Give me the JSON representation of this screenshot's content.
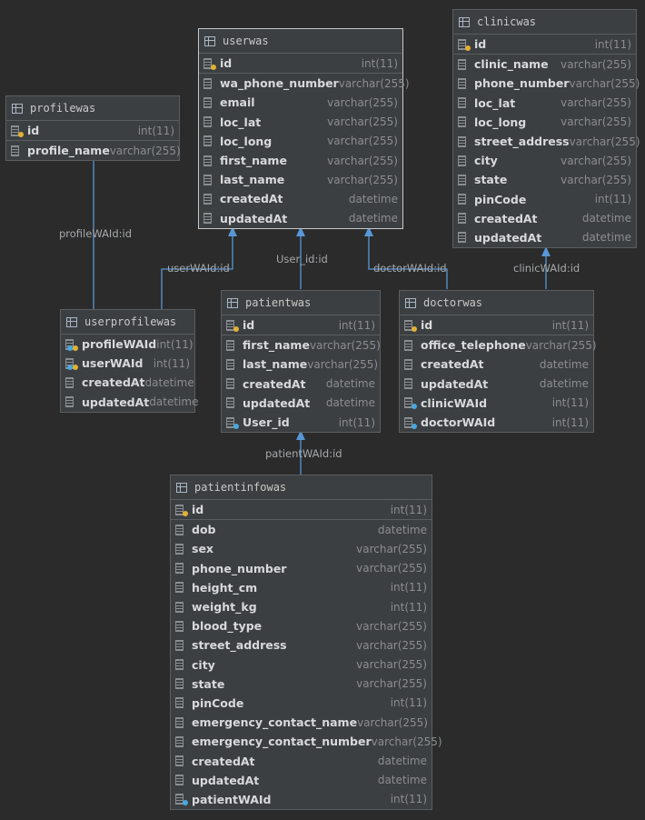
{
  "tables": [
    {
      "key": "userwas",
      "name": "userwas",
      "columns": [
        {
          "name": "id",
          "type": "int(11)",
          "icon": "primary-key-icon"
        },
        {
          "name": "wa_phone_number",
          "type": "varchar(255)",
          "icon": "column-icon"
        },
        {
          "name": "email",
          "type": "varchar(255)",
          "icon": "column-icon"
        },
        {
          "name": "loc_lat",
          "type": "varchar(255)",
          "icon": "column-icon"
        },
        {
          "name": "loc_long",
          "type": "varchar(255)",
          "icon": "column-icon"
        },
        {
          "name": "first_name",
          "type": "varchar(255)",
          "icon": "column-icon"
        },
        {
          "name": "last_name",
          "type": "varchar(255)",
          "icon": "column-icon"
        },
        {
          "name": "createdAt",
          "type": "datetime",
          "icon": "column-icon"
        },
        {
          "name": "updatedAt",
          "type": "datetime",
          "icon": "column-icon"
        }
      ]
    },
    {
      "key": "clinicwas",
      "name": "clinicwas",
      "columns": [
        {
          "name": "id",
          "type": "int(11)",
          "icon": "primary-key-icon"
        },
        {
          "name": "clinic_name",
          "type": "varchar(255)",
          "icon": "column-icon"
        },
        {
          "name": "phone_number",
          "type": "varchar(255)",
          "icon": "column-icon"
        },
        {
          "name": "loc_lat",
          "type": "varchar(255)",
          "icon": "column-icon"
        },
        {
          "name": "loc_long",
          "type": "varchar(255)",
          "icon": "column-icon"
        },
        {
          "name": "street_address",
          "type": "varchar(255)",
          "icon": "column-icon"
        },
        {
          "name": "city",
          "type": "varchar(255)",
          "icon": "column-icon"
        },
        {
          "name": "state",
          "type": "varchar(255)",
          "icon": "column-icon"
        },
        {
          "name": "pinCode",
          "type": "int(11)",
          "icon": "column-icon"
        },
        {
          "name": "createdAt",
          "type": "datetime",
          "icon": "column-icon"
        },
        {
          "name": "updatedAt",
          "type": "datetime",
          "icon": "column-icon"
        }
      ]
    },
    {
      "key": "profilewas",
      "name": "profilewas",
      "columns": [
        {
          "name": "id",
          "type": "int(11)",
          "icon": "primary-key-icon"
        },
        {
          "name": "profile_name",
          "type": "varchar(255)",
          "icon": "column-icon"
        }
      ]
    },
    {
      "key": "userprofilewas",
      "name": "userprofilewas",
      "columns": [
        {
          "name": "profileWAId",
          "type": "int(11)",
          "icon": "primary-foreign-key-icon"
        },
        {
          "name": "userWAId",
          "type": "int(11)",
          "icon": "primary-foreign-key-icon"
        },
        {
          "name": "createdAt",
          "type": "datetime",
          "icon": "column-icon"
        },
        {
          "name": "updatedAt",
          "type": "datetime",
          "icon": "column-icon"
        }
      ]
    },
    {
      "key": "patientwas",
      "name": "patientwas",
      "columns": [
        {
          "name": "id",
          "type": "int(11)",
          "icon": "primary-key-icon"
        },
        {
          "name": "first_name",
          "type": "varchar(255)",
          "icon": "column-icon"
        },
        {
          "name": "last_name",
          "type": "varchar(255)",
          "icon": "column-icon"
        },
        {
          "name": "createdAt",
          "type": "datetime",
          "icon": "column-icon"
        },
        {
          "name": "updatedAt",
          "type": "datetime",
          "icon": "column-icon"
        },
        {
          "name": "User_id",
          "type": "int(11)",
          "icon": "foreign-key-icon"
        }
      ]
    },
    {
      "key": "doctorwas",
      "name": "doctorwas",
      "columns": [
        {
          "name": "id",
          "type": "int(11)",
          "icon": "primary-key-icon"
        },
        {
          "name": "office_telephone",
          "type": "varchar(255)",
          "icon": "column-icon"
        },
        {
          "name": "createdAt",
          "type": "datetime",
          "icon": "column-icon"
        },
        {
          "name": "updatedAt",
          "type": "datetime",
          "icon": "column-icon"
        },
        {
          "name": "clinicWAId",
          "type": "int(11)",
          "icon": "foreign-key-icon"
        },
        {
          "name": "doctorWAId",
          "type": "int(11)",
          "icon": "foreign-key-icon"
        }
      ]
    },
    {
      "key": "patientinfowas",
      "name": "patientinfowas",
      "columns": [
        {
          "name": "id",
          "type": "int(11)",
          "icon": "primary-key-icon"
        },
        {
          "name": "dob",
          "type": "datetime",
          "icon": "column-icon"
        },
        {
          "name": "sex",
          "type": "varchar(255)",
          "icon": "column-icon"
        },
        {
          "name": "phone_number",
          "type": "varchar(255)",
          "icon": "column-icon"
        },
        {
          "name": "height_cm",
          "type": "int(11)",
          "icon": "column-icon"
        },
        {
          "name": "weight_kg",
          "type": "int(11)",
          "icon": "column-icon"
        },
        {
          "name": "blood_type",
          "type": "varchar(255)",
          "icon": "column-icon"
        },
        {
          "name": "street_address",
          "type": "varchar(255)",
          "icon": "column-icon"
        },
        {
          "name": "city",
          "type": "varchar(255)",
          "icon": "column-icon"
        },
        {
          "name": "state",
          "type": "varchar(255)",
          "icon": "column-icon"
        },
        {
          "name": "pinCode",
          "type": "int(11)",
          "icon": "column-icon"
        },
        {
          "name": "emergency_contact_name",
          "type": "varchar(255)",
          "icon": "column-icon"
        },
        {
          "name": "emergency_contact_number",
          "type": "varchar(255)",
          "icon": "column-icon"
        },
        {
          "name": "createdAt",
          "type": "datetime",
          "icon": "column-icon"
        },
        {
          "name": "updatedAt",
          "type": "datetime",
          "icon": "column-icon"
        },
        {
          "name": "patientWAId",
          "type": "int(11)",
          "icon": "foreign-key-icon"
        }
      ]
    }
  ],
  "edges": [
    {
      "label": "profileWAId:id"
    },
    {
      "label": "userWAId:id"
    },
    {
      "label": "User_id:id"
    },
    {
      "label": "doctorWAId:id"
    },
    {
      "label": "clinicWAId:id"
    },
    {
      "label": "patientWAId:id"
    }
  ],
  "colors": {
    "edge": "#5897d6",
    "background": "#2b2b2b",
    "table": "#3c3f41"
  }
}
